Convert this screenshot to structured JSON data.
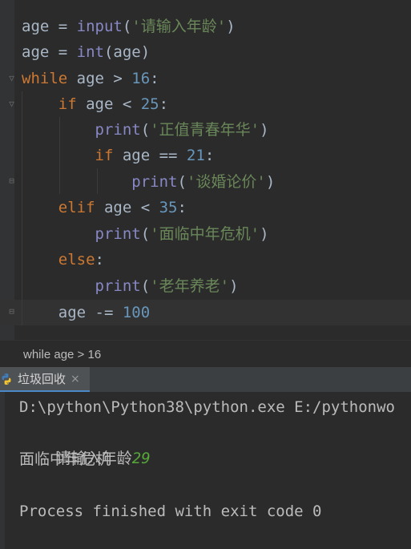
{
  "editor": {
    "lines": [
      {
        "tokens": [
          {
            "text": "age",
            "cls": "id"
          },
          {
            "text": " = ",
            "cls": "id"
          },
          {
            "text": "input",
            "cls": "builtin"
          },
          {
            "text": "(",
            "cls": "id"
          },
          {
            "text": "'请输入年龄'",
            "cls": "str"
          },
          {
            "text": ")",
            "cls": "id"
          }
        ]
      },
      {
        "tokens": [
          {
            "text": "age",
            "cls": "id"
          },
          {
            "text": " = ",
            "cls": "id"
          },
          {
            "text": "int",
            "cls": "builtin"
          },
          {
            "text": "(age)",
            "cls": "id"
          }
        ]
      },
      {
        "tokens": [
          {
            "text": "while",
            "cls": "kw"
          },
          {
            "text": " age > ",
            "cls": "id"
          },
          {
            "text": "16",
            "cls": "num"
          },
          {
            "text": ":",
            "cls": "id"
          }
        ]
      },
      {
        "tokens": [
          {
            "text": "    ",
            "cls": "id"
          },
          {
            "text": "if",
            "cls": "kw"
          },
          {
            "text": " age < ",
            "cls": "id"
          },
          {
            "text": "25",
            "cls": "num"
          },
          {
            "text": ":",
            "cls": "id"
          }
        ]
      },
      {
        "tokens": [
          {
            "text": "        ",
            "cls": "id"
          },
          {
            "text": "print",
            "cls": "builtin"
          },
          {
            "text": "(",
            "cls": "id"
          },
          {
            "text": "'正值青春年华'",
            "cls": "str"
          },
          {
            "text": ")",
            "cls": "id"
          }
        ]
      },
      {
        "tokens": [
          {
            "text": "        ",
            "cls": "id"
          },
          {
            "text": "if",
            "cls": "kw"
          },
          {
            "text": " age == ",
            "cls": "id"
          },
          {
            "text": "21",
            "cls": "num"
          },
          {
            "text": ":",
            "cls": "id"
          }
        ]
      },
      {
        "tokens": [
          {
            "text": "            ",
            "cls": "id"
          },
          {
            "text": "print",
            "cls": "builtin"
          },
          {
            "text": "(",
            "cls": "id"
          },
          {
            "text": "'谈婚论价'",
            "cls": "str"
          },
          {
            "text": ")",
            "cls": "id"
          }
        ]
      },
      {
        "tokens": [
          {
            "text": "    ",
            "cls": "id"
          },
          {
            "text": "elif",
            "cls": "kw"
          },
          {
            "text": " age < ",
            "cls": "id"
          },
          {
            "text": "35",
            "cls": "num"
          },
          {
            "text": ":",
            "cls": "id"
          }
        ]
      },
      {
        "tokens": [
          {
            "text": "        ",
            "cls": "id"
          },
          {
            "text": "print",
            "cls": "builtin"
          },
          {
            "text": "(",
            "cls": "id"
          },
          {
            "text": "'面临中年危机'",
            "cls": "str"
          },
          {
            "text": ")",
            "cls": "id"
          }
        ]
      },
      {
        "tokens": [
          {
            "text": "    ",
            "cls": "id"
          },
          {
            "text": "else",
            "cls": "kw"
          },
          {
            "text": ":",
            "cls": "id"
          }
        ]
      },
      {
        "tokens": [
          {
            "text": "        ",
            "cls": "id"
          },
          {
            "text": "print",
            "cls": "builtin"
          },
          {
            "text": "(",
            "cls": "id"
          },
          {
            "text": "'老年养老'",
            "cls": "str"
          },
          {
            "text": ")",
            "cls": "id"
          }
        ]
      },
      {
        "tokens": [
          {
            "text": "    ",
            "cls": "id"
          },
          {
            "text": "age -= ",
            "cls": "id"
          },
          {
            "text": "100",
            "cls": "num"
          }
        ]
      }
    ]
  },
  "breadcrumb": {
    "text": "while age > 16"
  },
  "run_panel": {
    "tab_label": "垃圾回收",
    "close_glyph": "×",
    "console": {
      "command": "D:\\python\\Python38\\python.exe E:/pythonwo",
      "prompt": "请输入年龄",
      "user_input": "29",
      "output": "面临中年危机",
      "blank": "",
      "exit_message": "Process finished with exit code 0"
    }
  },
  "colors": {
    "keyword": "#cc7832",
    "builtin": "#8888c6",
    "number": "#6897bb",
    "string": "#6a8759",
    "identifier": "#a9b7c6",
    "user_input": "#56a839",
    "background": "#2b2b2b"
  }
}
